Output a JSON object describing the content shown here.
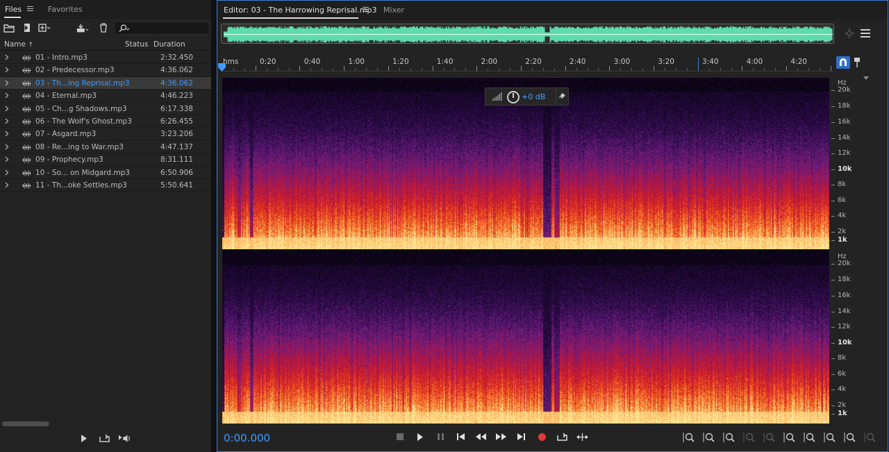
{
  "files_panel": {
    "tabs": {
      "files": "Files",
      "favorites": "Favorites"
    },
    "search": {
      "value": "",
      "placeholder": ""
    },
    "columns": {
      "name": "Name",
      "status": "Status",
      "duration": "Duration"
    },
    "files": [
      {
        "name": "01 - Intro.mp3",
        "status": "",
        "duration": "2:32.450",
        "selected": false
      },
      {
        "name": "02 - Predecessor.mp3",
        "status": "",
        "duration": "4:36.062",
        "selected": false
      },
      {
        "name": "03 - Th...ing Reprisal.mp3",
        "status": "",
        "duration": "4:36.062",
        "selected": true
      },
      {
        "name": "04 - Eternal.mp3",
        "status": "",
        "duration": "4:46.223",
        "selected": false
      },
      {
        "name": "05 - Ch...g Shadows.mp3",
        "status": "",
        "duration": "6:17.338",
        "selected": false
      },
      {
        "name": "06 - The Wolf's Ghost.mp3",
        "status": "",
        "duration": "6:26.455",
        "selected": false
      },
      {
        "name": "07 - Asgard.mp3",
        "status": "",
        "duration": "3:23.206",
        "selected": false
      },
      {
        "name": "08 - Re...ing to War.mp3",
        "status": "",
        "duration": "4:47.137",
        "selected": false
      },
      {
        "name": "09 - Prophecy.mp3",
        "status": "",
        "duration": "8:31.111",
        "selected": false
      },
      {
        "name": "10 - So... on Midgard.mp3",
        "status": "",
        "duration": "6:50.906",
        "selected": false
      },
      {
        "name": "11 - Th...oke Settles.mp3",
        "status": "",
        "duration": "5:50.641",
        "selected": false
      }
    ],
    "icons": {
      "toolbar": [
        "open-folder-icon",
        "import-file-icon",
        "new-file-icon",
        "insert-into-multitrack-icon",
        "trash-icon"
      ],
      "transport": [
        "play-icon",
        "loop-icon",
        "auto-play-icon"
      ]
    }
  },
  "editor": {
    "tab_title": "Editor: 03 - The Harrowing Reprisal.mp3",
    "mixer_tab": "Mixer",
    "ruler": {
      "unit": "hms",
      "labels": [
        "0:20",
        "0:40",
        "1:00",
        "1:20",
        "1:40",
        "2:00",
        "2:20",
        "2:40",
        "3:00",
        "3:20",
        "3:40",
        "4:00",
        "4:20"
      ]
    },
    "hud": {
      "gain": "+0 dB"
    },
    "frequency_axis": {
      "unit": "Hz",
      "labels": [
        "20k",
        "18k",
        "16k",
        "14k",
        "12k",
        "10k",
        "8k",
        "6k",
        "4k",
        "2k",
        "1k"
      ],
      "bold": [
        "10k",
        "1k"
      ]
    },
    "time_display": "0:00.000",
    "colors": {
      "accent": "#3f9bff",
      "overview_wave": "#5fdcae",
      "record": "#e03a3a",
      "spectrogram_low": "#1a0a2e",
      "spectrogram_mid": "#c2142c",
      "spectrogram_high": "#ffd36b"
    },
    "transport_icons": [
      "stop-icon",
      "play-icon",
      "pause-icon",
      "go-to-start-icon",
      "rewind-icon",
      "fast-forward-icon",
      "go-to-end-icon",
      "record-icon",
      "loop-icon",
      "skip-selection-icon"
    ],
    "zoom_icons": [
      "zoom-in-amplitude-icon",
      "zoom-out-amplitude-icon",
      "zoom-in-time-icon",
      "zoom-out-time-icon",
      "zoom-reset-icon",
      "zoom-in-left-icon",
      "zoom-in-right-icon",
      "zoom-full-icon",
      "zoom-selection-icon",
      "zoom-extra-icon"
    ]
  }
}
